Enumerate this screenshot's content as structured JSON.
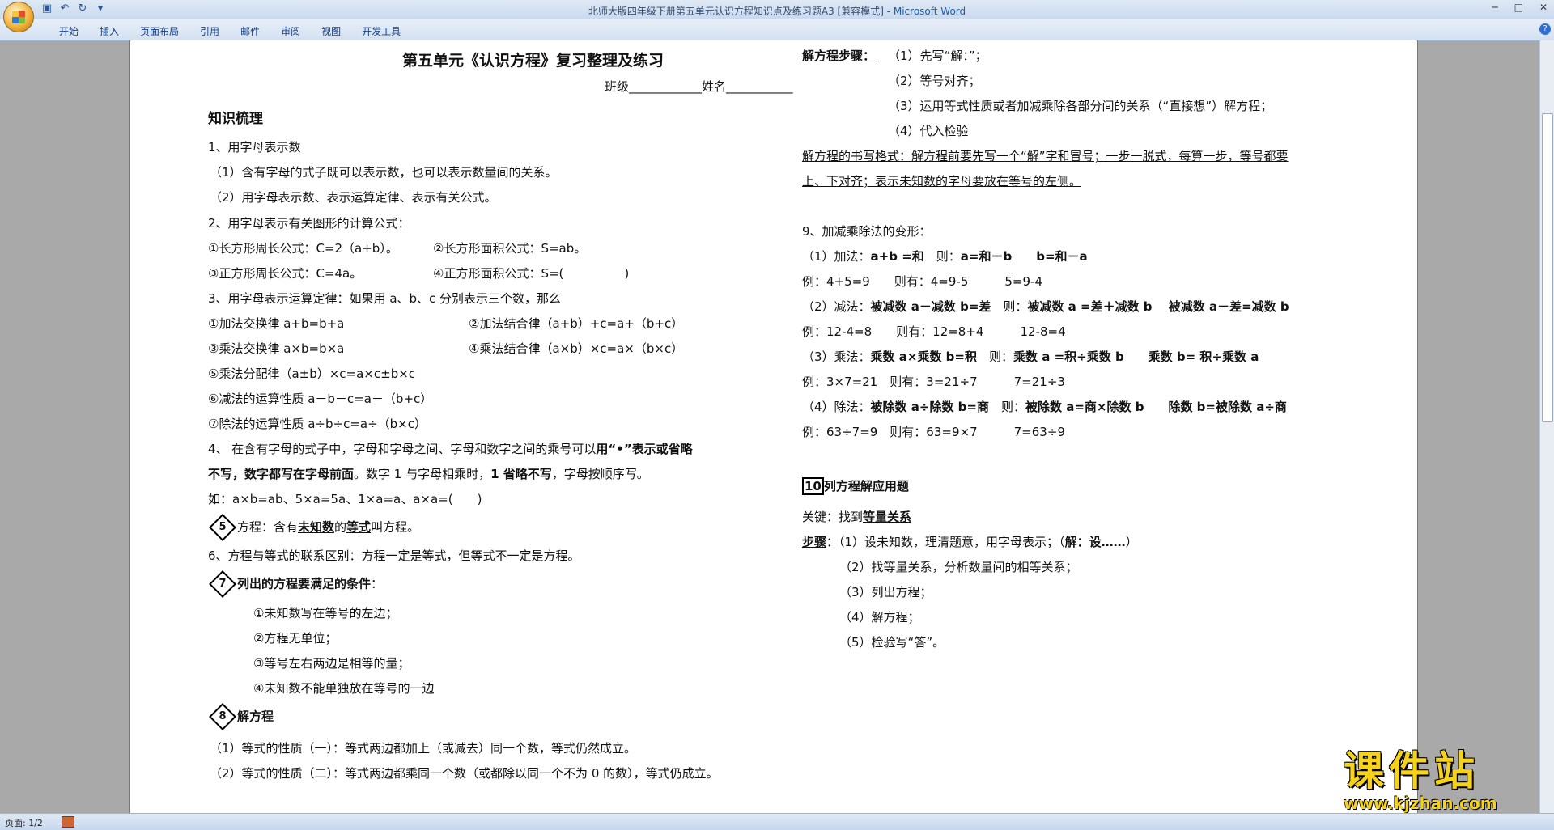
{
  "window": {
    "title_doc": "北师大版四年级下册第五单元认识方程知识点及练习题A3 [兼容模式]",
    "title_sep": " - ",
    "title_app": "Microsoft Word"
  },
  "ribbon": {
    "tabs": [
      "开始",
      "插入",
      "页面布局",
      "引用",
      "邮件",
      "审阅",
      "视图",
      "开发工具"
    ]
  },
  "status": {
    "page": "页面: 1/2"
  },
  "doc": {
    "title": "第五单元《认识方程》复习整理及练习",
    "class_line": "班级____________姓名___________",
    "left": {
      "h_knowledge": "知识梳理",
      "s1": "1、用字母表示数",
      "s1a": "（1）含有字母的式子既可以表示数，也可以表示数量间的关系。",
      "s1b": "（2）用字母表示数、表示运算定律、表示有关公式。",
      "s2": "2、用字母表示有关图形的计算公式：",
      "f1": "①长方形周长公式：C=2（a+b）。",
      "f2": "②长方形面积公式：S=ab。",
      "f3": "③正方形周长公式：C=4a。",
      "f4": "④正方形面积公式：S=(　　　　　)",
      "s3": "3、用字母表示运算定律：如果用 a、b、c 分别表示三个数，那么",
      "l1": "①加法交换律 a+b=b+a",
      "l2": "②加法结合律（a+b）+c=a+（b+c）",
      "l3": "③乘法交换律 a×b=b×a",
      "l4": "④乘法结合律（a×b）×c=a×（b×c）",
      "l5": "⑤乘法分配律（a±b）×c=a×c±b×c",
      "l6": "⑥减法的运算性质 a－b－c=a－（b+c）",
      "l7": "⑦除法的运算性质 a÷b÷c=a÷（b×c）",
      "s4a": "4、 在含有字母的式子中，字母和字母之间、字母和数字之间的乘号可以",
      "s4b": "用“•”表示或省略",
      "s4c": "不写，数字都写在字母前面",
      "s4d": "。数字 1 与字母相乘时，",
      "s4e": "1 省略不写",
      "s4f": "，字母按顺序写。",
      "s4g": "如：a×b=ab、5×a=5a、1×a=a、a×a=(　　)",
      "n5": "5",
      "s5a": "方程：含有",
      "s5b": "未知数",
      "s5c": "的",
      "s5d": "等式",
      "s5e": "叫方程。",
      "s6": "6、方程与等式的联系区别：方程一定是等式，但等式不一定是方程。",
      "n7": "7",
      "s7": "列出的方程要满足的条件",
      "s7c": "：",
      "c1": "①未知数写在等号的左边；",
      "c2": "②方程无单位；",
      "c3": "③等号左右两边是相等的量；",
      "c4": "④未知数不能单独放在等号的一边",
      "n8": "8",
      "s8": "解方程",
      "p1": "（1）等式的性质（一）：等式两边都加上（或减去）同一个数，等式仍然成立。",
      "p2": "（2）等式的性质（二）：等式两边都乘同一个数（或都除以同一个不为 0 的数），等式仍成立。"
    },
    "right": {
      "steps_h": "解方程步骤：",
      "st1": "（1）先写“解：”；",
      "st2": "（2）等号对齐；",
      "st3": "（3）运用等式性质或者加减乘除各部分间的关系（“直接想”）解方程；",
      "st4": "（4）代入检验",
      "fmt1": "解方程的书写格式：解方程前要先写一个“解”字和冒号；一步一脱式，每算一步，等号都要",
      "fmt2": "上、下对齐；表示未知数的字母要放在等号的左侧。",
      "s9": "9、加减乘除法的变形：",
      "add1": "（1）加法：",
      "add2": "a+b =和",
      "add3": "　则：",
      "add4": "a=和－b　　b=和－a",
      "add_ex": " 例：4+5=9　　则有：4=9-5　　　5=9-4",
      "sub1": "（2）减法：",
      "sub2": "被减数 a－减数 b=差",
      "sub3": "　则：",
      "sub4": "被减数 a =差＋减数 b　 被减数 a－差=减数 b",
      "sub_ex": "例：12-4=8　　则有：12=8+4　　　12-8=4",
      "mul1": "（3）乘法：",
      "mul2": "乘数 a×乘数 b=积",
      "mul3": "　则：",
      "mul4": "乘数 a =积÷乘数 b　　乘数 b= 积÷乘数 a",
      "mul_ex": "例：3×7=21　则有：3=21÷7　　　7=21÷3",
      "div1": "（4）除法：",
      "div2": "被除数 a÷除数 b=商",
      "div3": "　则：",
      "div4": "被除数 a=商×除数 b　　除数 b=被除数 a÷商",
      "div_ex": "例：63÷7=9　则有：63=9×7　　　7=63÷9",
      "n10": "10",
      "s10": "列方程解应用题",
      "key1": "关键：找到",
      "key2": "等量关系",
      "steps2_h": "步骤",
      "step2a": "：（1）设未知数，理清题意，用字母表示；（",
      "step2b": "解：设……",
      "step2c": "）",
      "k2": "（2）找等量关系，分析数量间的相等关系；",
      "k3": "（3）列出方程；",
      "k4": "（4）解方程；",
      "k5": "（5）检验写“答”。"
    }
  },
  "watermark": {
    "cn": "课件站",
    "url": "www.kjzhan.com"
  }
}
